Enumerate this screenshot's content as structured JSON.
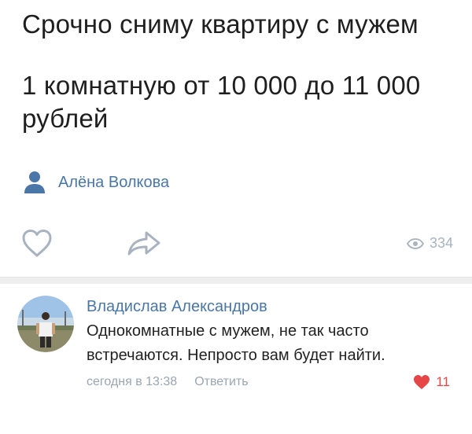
{
  "post": {
    "line1": "Срочно сниму квартиру с мужем",
    "line2": "1 комнатную от 10 000 до 11 000",
    "line3": "рублей",
    "signer_name": "Алёна Волкова"
  },
  "actions": {
    "views_count": "334"
  },
  "comment": {
    "author": "Владислав Александров",
    "text_line1": "Однокомнатные с мужем, не так часто",
    "text_line2": "встречаются. Непросто вам будет найти.",
    "timestamp": "сегодня в 13:38",
    "reply_label": "Ответить",
    "likes_count": "11"
  },
  "icons": {
    "signer": "person-icon",
    "like": "heart-outline-icon",
    "share": "share-arrow-icon",
    "views": "eye-icon",
    "comment_like": "heart-filled-icon"
  },
  "colors": {
    "link_blue": "#4a76a8",
    "icon_gray": "#a8b3bf",
    "like_red": "#e64646",
    "text": "#222222"
  }
}
